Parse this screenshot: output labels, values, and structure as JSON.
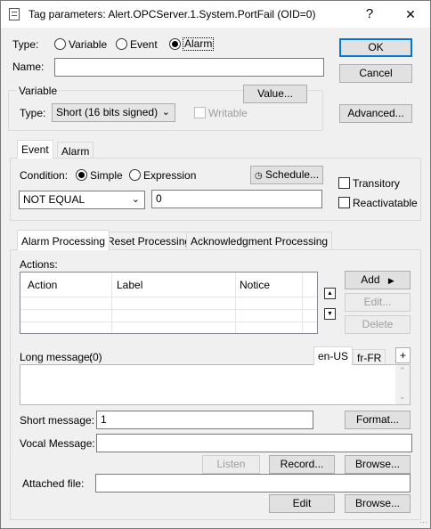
{
  "window": {
    "title": "Tag parameters: Alert.OPCServer.1.System.PortFail (OID=0)",
    "help_glyph": "?",
    "close_glyph": "✕",
    "icon": "dialog-icon"
  },
  "type": {
    "label": "Type:",
    "options": [
      "Variable",
      "Event",
      "Alarm"
    ],
    "selected": "Alarm"
  },
  "name": {
    "label": "Name:",
    "value": ""
  },
  "buttons": {
    "ok": "OK",
    "cancel": "Cancel",
    "advanced": "Advanced..."
  },
  "variable": {
    "group_label": "Variable",
    "value_button": "Value...",
    "type_label": "Type:",
    "type_value": "Short (16 bits signed)",
    "writable_label": "Writable"
  },
  "event_tabs": [
    "Event",
    "Alarm"
  ],
  "event": {
    "condition_label": "Condition:",
    "condition_options": [
      "Simple",
      "Expression"
    ],
    "condition_selected": "Simple",
    "schedule_button": "Schedule...",
    "schedule_icon": "clock-icon",
    "operator": "NOT EQUAL",
    "threshold": "0",
    "transitory_label": "Transitory",
    "reactivatable_label": "Reactivatable"
  },
  "processing_tabs": [
    "Alarm Processing",
    "Reset Processing",
    "Acknowledgment Processing"
  ],
  "actions": {
    "label": "Actions:",
    "columns": [
      "Action",
      "Label",
      "Notice"
    ],
    "add_button": "Add",
    "edit_button": "Edit...",
    "delete_button": "Delete"
  },
  "long_message": {
    "label": "Long message:",
    "count": "(0)",
    "lang_tabs": [
      "en-US",
      "fr-FR"
    ],
    "add_lang": "+"
  },
  "short_message": {
    "label": "Short message:",
    "value": "1",
    "format_button": "Format..."
  },
  "vocal_message": {
    "label": "Vocal Message:",
    "value": "",
    "listen_button": "Listen",
    "record_button": "Record...",
    "browse_button": "Browse..."
  },
  "attached_file": {
    "label": "Attached file:",
    "value": "",
    "edit_button": "Edit",
    "browse_button": "Browse..."
  }
}
